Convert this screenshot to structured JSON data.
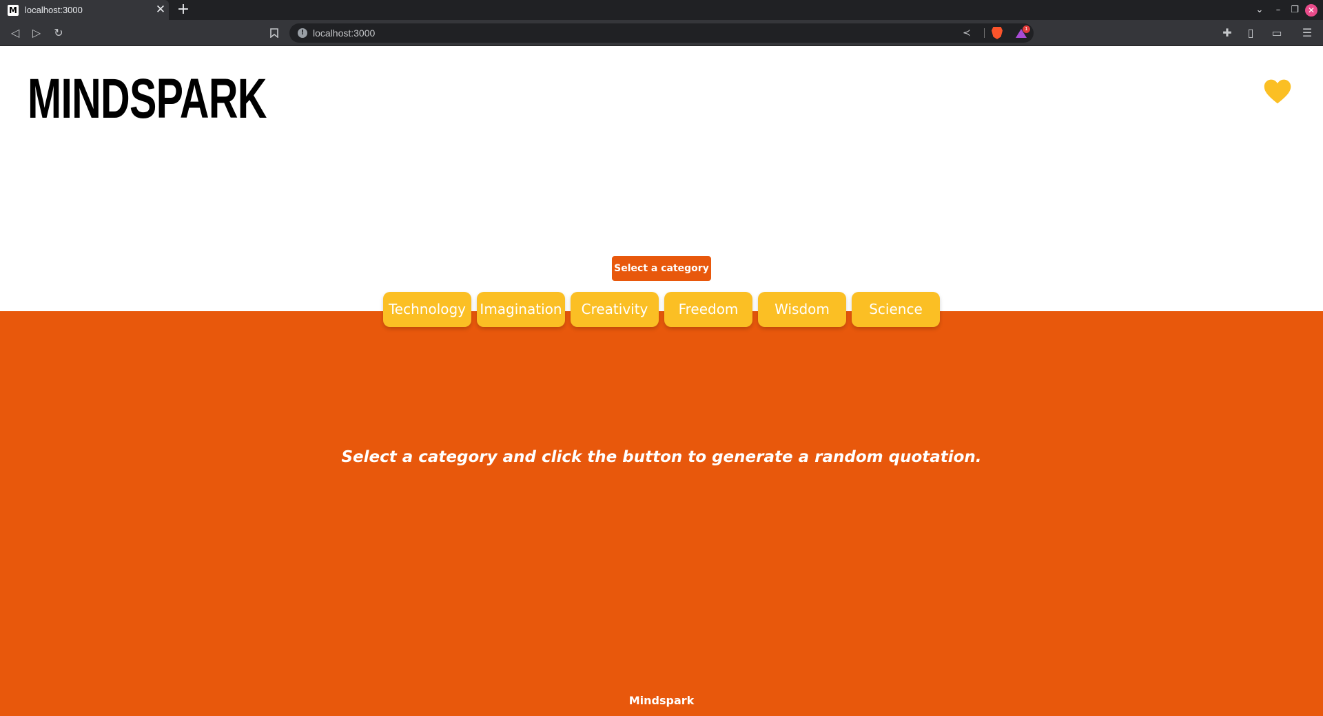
{
  "browser": {
    "tab_title": "localhost:3000",
    "favicon_letter": "M",
    "url": "localhost:3000",
    "rewards_badge": "1"
  },
  "header": {
    "logo": "MINDSPARK",
    "favorites_icon": "heart-icon",
    "heart_color": "#fbbf24"
  },
  "controls": {
    "select_button": "Select a category",
    "categories": [
      "Technology",
      "Imagination",
      "Creativity",
      "Freedom",
      "Wisdom",
      "Science"
    ]
  },
  "quote": {
    "prompt": "Select a category and click the button to generate a random quotation."
  },
  "footer": {
    "text": "Mindspark"
  },
  "colors": {
    "accent_orange": "#e8580c",
    "category_yellow": "#fbbf24"
  }
}
